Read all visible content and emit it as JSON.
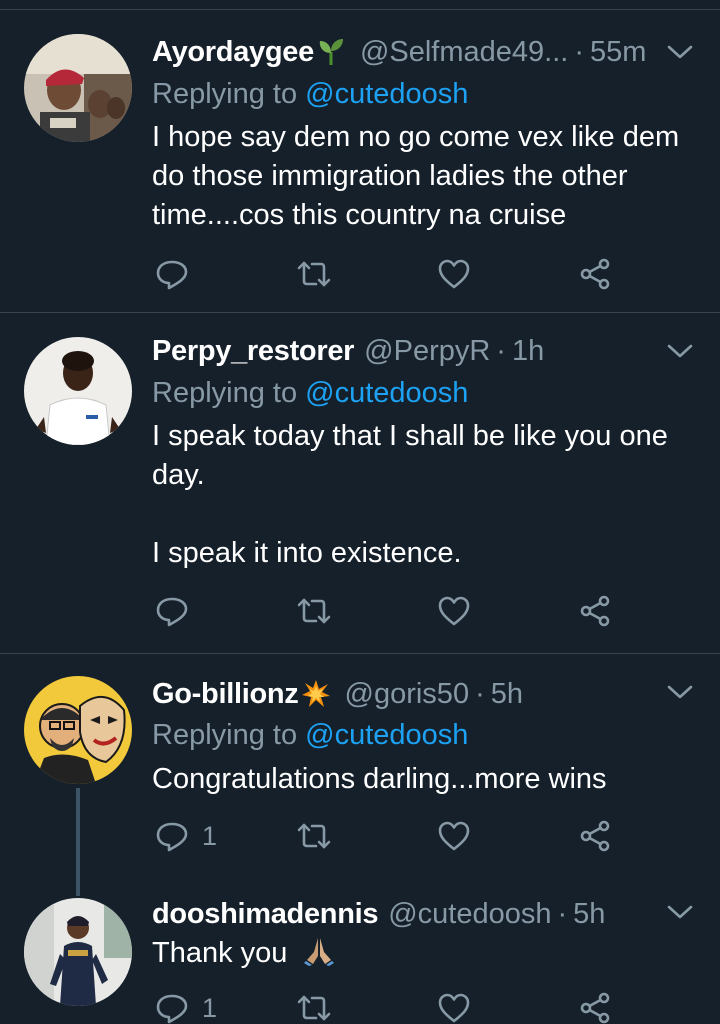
{
  "tweets": [
    {
      "name": "Ayordaygee",
      "name_emoji": "seedling-emoji",
      "handle": "@Selfmade49...",
      "dot": "·",
      "time": "55m",
      "replying_prefix": "Replying to",
      "replying_to": "@cutedoosh",
      "text": "I hope say dem no go come vex like dem do those immigration ladies the other time....cos this country na cruise",
      "reply_count": "",
      "retweet_count": "",
      "like_count": ""
    },
    {
      "name": "Perpy_restorer",
      "name_emoji": "",
      "handle": "@PerpyR",
      "dot": "·",
      "time": "1h",
      "replying_prefix": "Replying to",
      "replying_to": "@cutedoosh",
      "text": "I speak today that I shall be like you one day.\n\nI speak it into  existence.",
      "reply_count": "",
      "retweet_count": "",
      "like_count": ""
    },
    {
      "name": "Go-billionz",
      "name_emoji": "collision-emoji",
      "handle": "@goris50",
      "dot": "·",
      "time": "5h",
      "replying_prefix": "Replying to",
      "replying_to": "@cutedoosh",
      "text": "Congratulations darling...more wins",
      "reply_count": "1",
      "retweet_count": "",
      "like_count": ""
    },
    {
      "name": "dooshimadennis",
      "name_emoji": "",
      "handle": "@cutedoosh",
      "dot": "·",
      "time": "5h",
      "text": "Thank you",
      "text_emoji": "folded-hands-emoji",
      "reply_count": "1",
      "retweet_count": "",
      "like_count": ""
    }
  ],
  "icons": {
    "reply": "reply-icon",
    "retweet": "retweet-icon",
    "like": "like-icon",
    "share": "share-icon",
    "more": "chevron-down-icon"
  },
  "colors": {
    "background": "#15202b",
    "divider": "#38444d",
    "secondary_text": "#8899a6",
    "link": "#1da1f2"
  }
}
